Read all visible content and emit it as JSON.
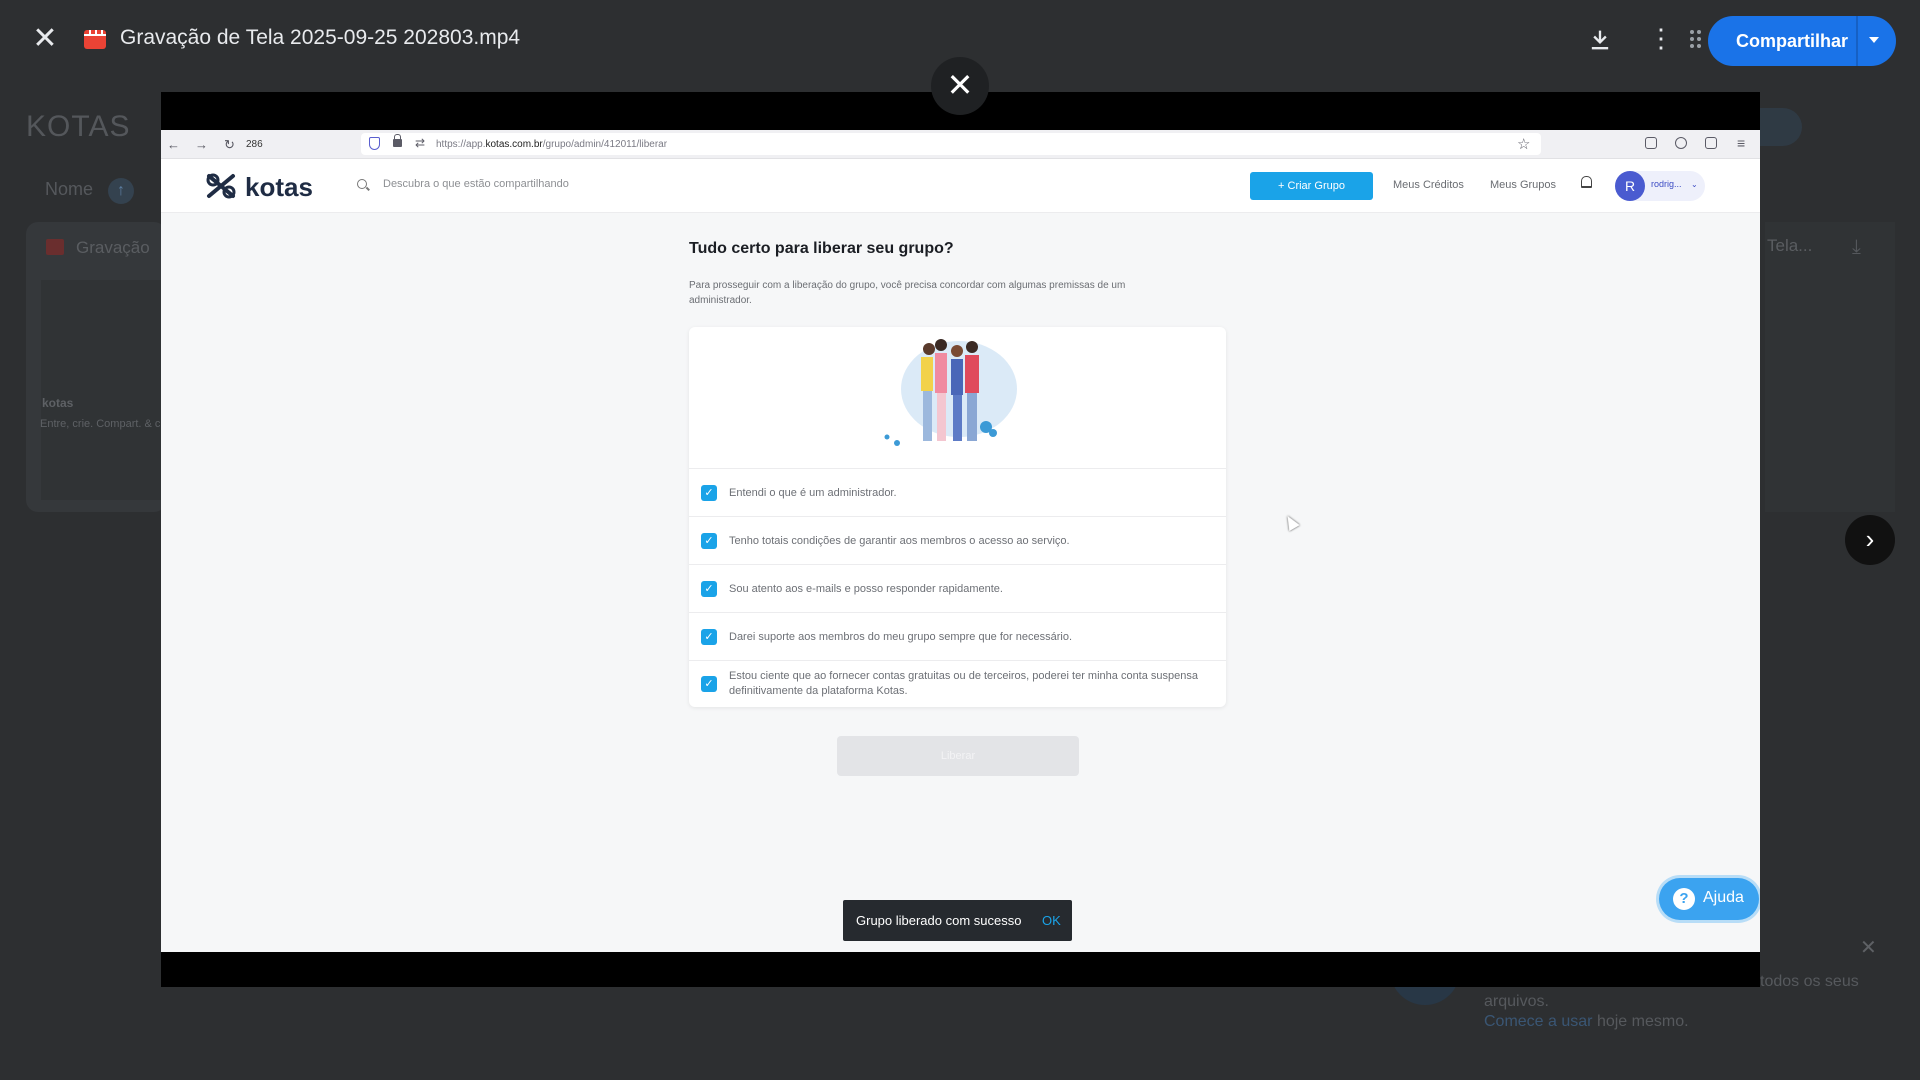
{
  "viewer": {
    "file_title": "Gravação de Tela 2025-09-25 202803.mp4",
    "share_label": "Compartilhar",
    "close_icon": "close-icon",
    "download_icon": "download-icon",
    "more_icon": "more-vert-icon",
    "share_color": "#1a73e8"
  },
  "background": {
    "title": "KOTAS",
    "sort_label": "Nome",
    "card_title": "Gravação",
    "card_brand": "kotas",
    "card_caption": "Entre, crie. Compart. & curta",
    "right_card_title": "Tela...",
    "promo_line1": "todos os seus",
    "promo_line2": "arquivos.",
    "promo_link": "Comece a usar",
    "promo_tail": "hoje mesmo."
  },
  "browser": {
    "zoom": "286",
    "url_prefix": "https://app.",
    "url_domain": "kotas.com.br",
    "url_path": "/grupo/admin/412011/liberar"
  },
  "site": {
    "brand": "kotas",
    "search_placeholder": "Descubra o que estão compartilhando",
    "create_button": "+ Criar Grupo",
    "nav": [
      "Meus Créditos",
      "Meus Grupos"
    ],
    "avatar_initial": "R",
    "user_name": "rodrig...",
    "accent": "#1aa3e8"
  },
  "page": {
    "title": "Tudo certo para liberar seu grupo?",
    "description": "Para prosseguir com a liberação do grupo, você precisa concordar com algumas premissas de um administrador.",
    "checks": [
      {
        "label": "Entendi o que é um administrador.",
        "checked": true
      },
      {
        "label": "Tenho totais condições de garantir aos membros o acesso ao serviço.",
        "checked": true
      },
      {
        "label": "Sou atento aos e-mails e posso responder rapidamente.",
        "checked": true
      },
      {
        "label": "Darei suporte aos membros do meu grupo sempre que for necessário.",
        "checked": true
      },
      {
        "label": "Estou ciente que ao fornecer contas gratuitas ou de terceiros, poderei ter minha conta suspensa definitivamente da plataforma Kotas.",
        "checked": true
      }
    ],
    "submit_label": "Liberar",
    "toast_message": "Grupo liberado com sucesso",
    "toast_action": "OK",
    "help_label": "Ajuda"
  }
}
